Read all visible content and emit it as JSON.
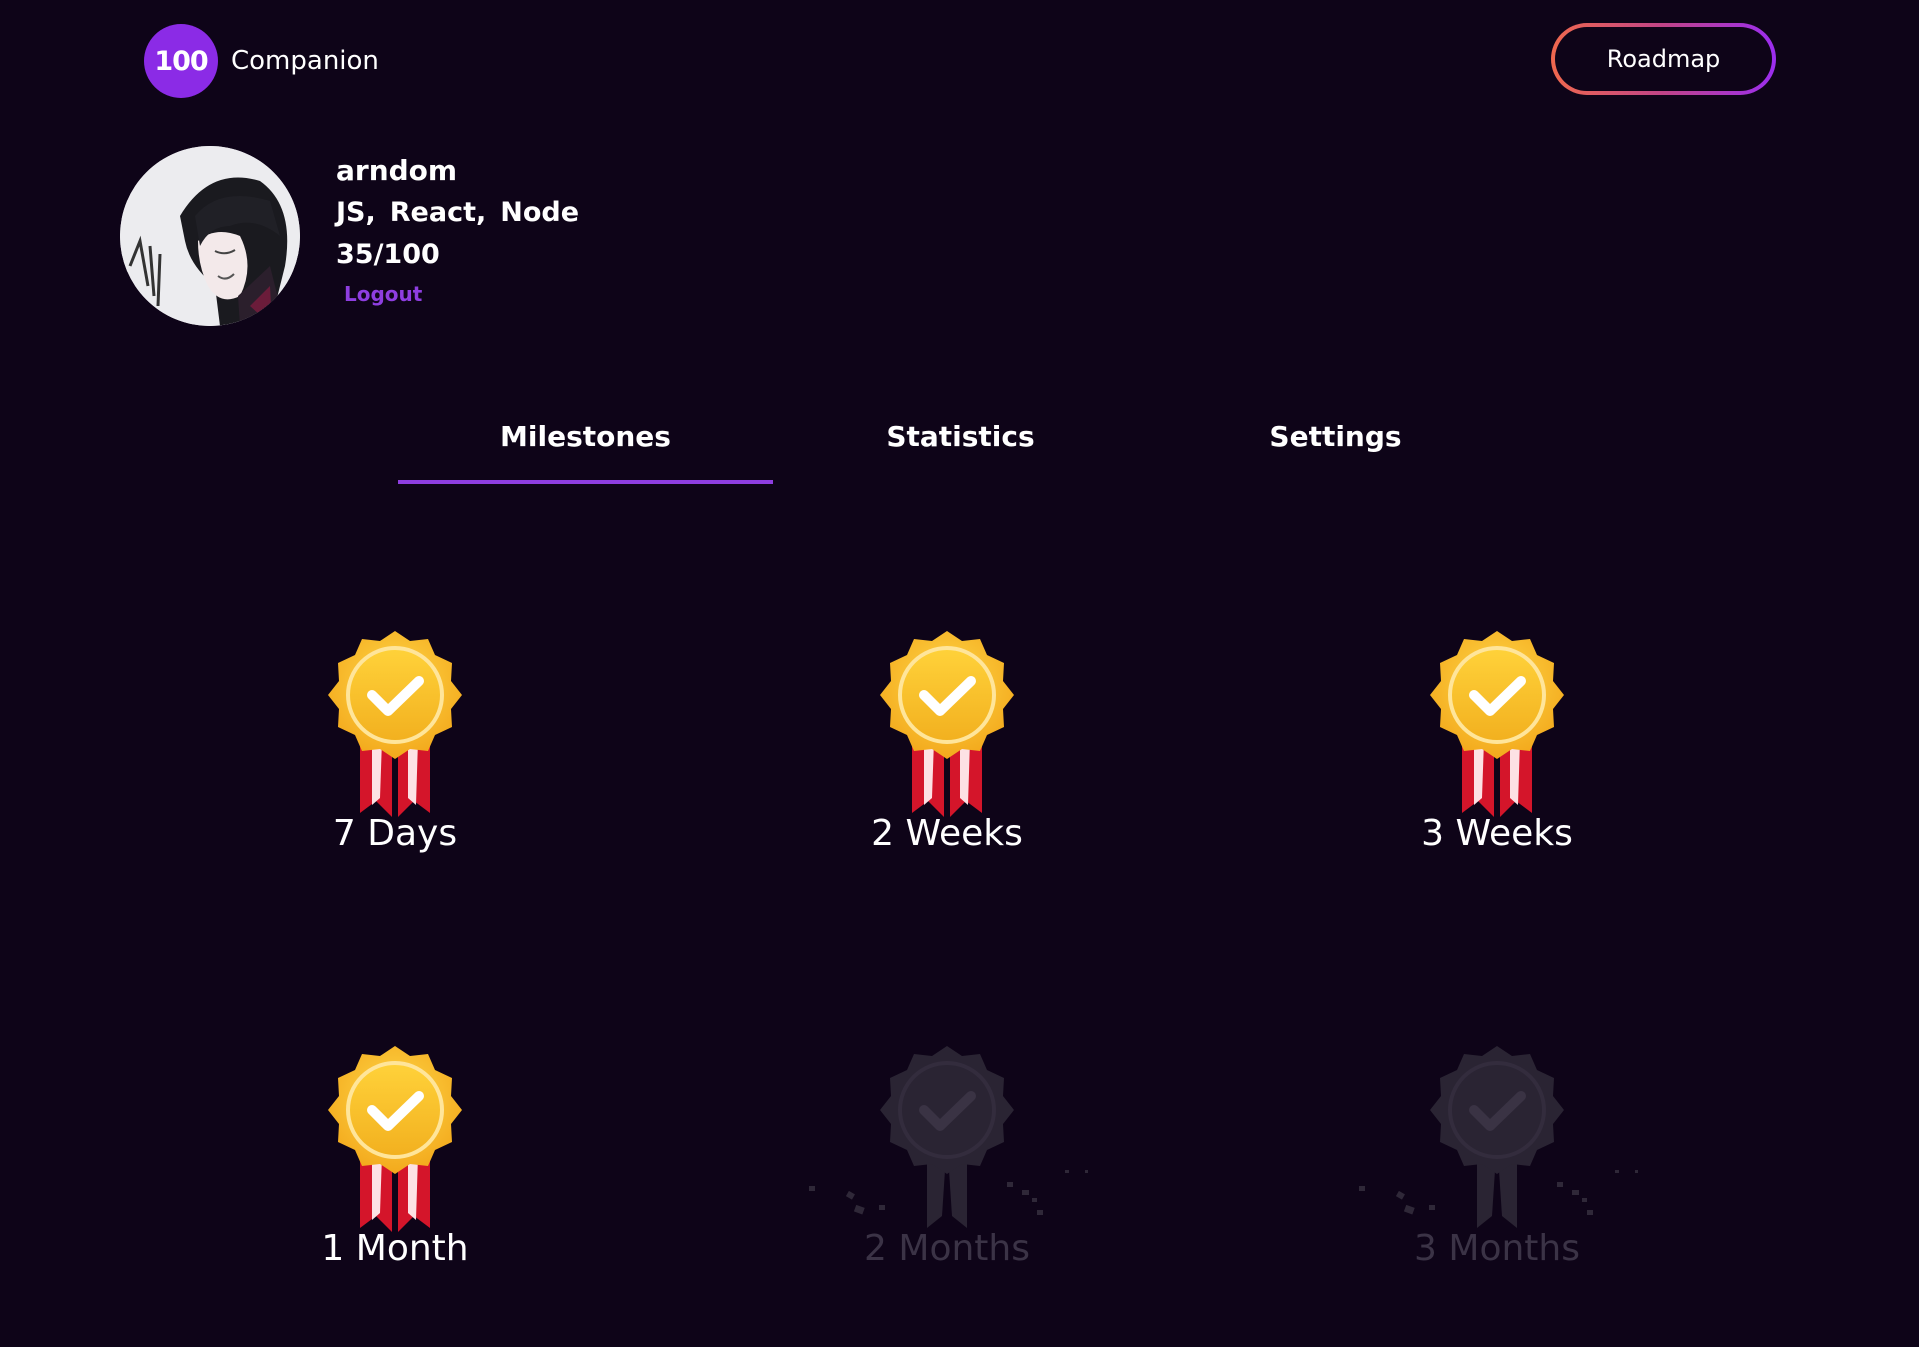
{
  "header": {
    "logo_badge": "100",
    "logo_text": "Companion",
    "roadmap_label": "Roadmap"
  },
  "profile": {
    "username": "arndom",
    "stack": [
      "JS,",
      "React,",
      "Node"
    ],
    "progress": "35/100",
    "logout_label": "Logout"
  },
  "tabs": [
    {
      "label": "Milestones",
      "active": true
    },
    {
      "label": "Statistics",
      "active": false
    },
    {
      "label": "Settings",
      "active": false
    }
  ],
  "milestones": [
    {
      "label": "7 Days",
      "achieved": true
    },
    {
      "label": "2 Weeks",
      "achieved": true
    },
    {
      "label": "3 Weeks",
      "achieved": true
    },
    {
      "label": "1 Month",
      "achieved": true
    },
    {
      "label": "2 Months",
      "achieved": false
    },
    {
      "label": "3 Months",
      "achieved": false
    }
  ],
  "icons": {
    "medal_achieved": "gold-medal-check-icon",
    "medal_locked": "locked-medal-icon"
  },
  "colors": {
    "background": "#0e0418",
    "accent": "#8e3ee0",
    "gold": "#f6c12c",
    "ribbon": "#d4152a",
    "locked": "#2a2433"
  }
}
